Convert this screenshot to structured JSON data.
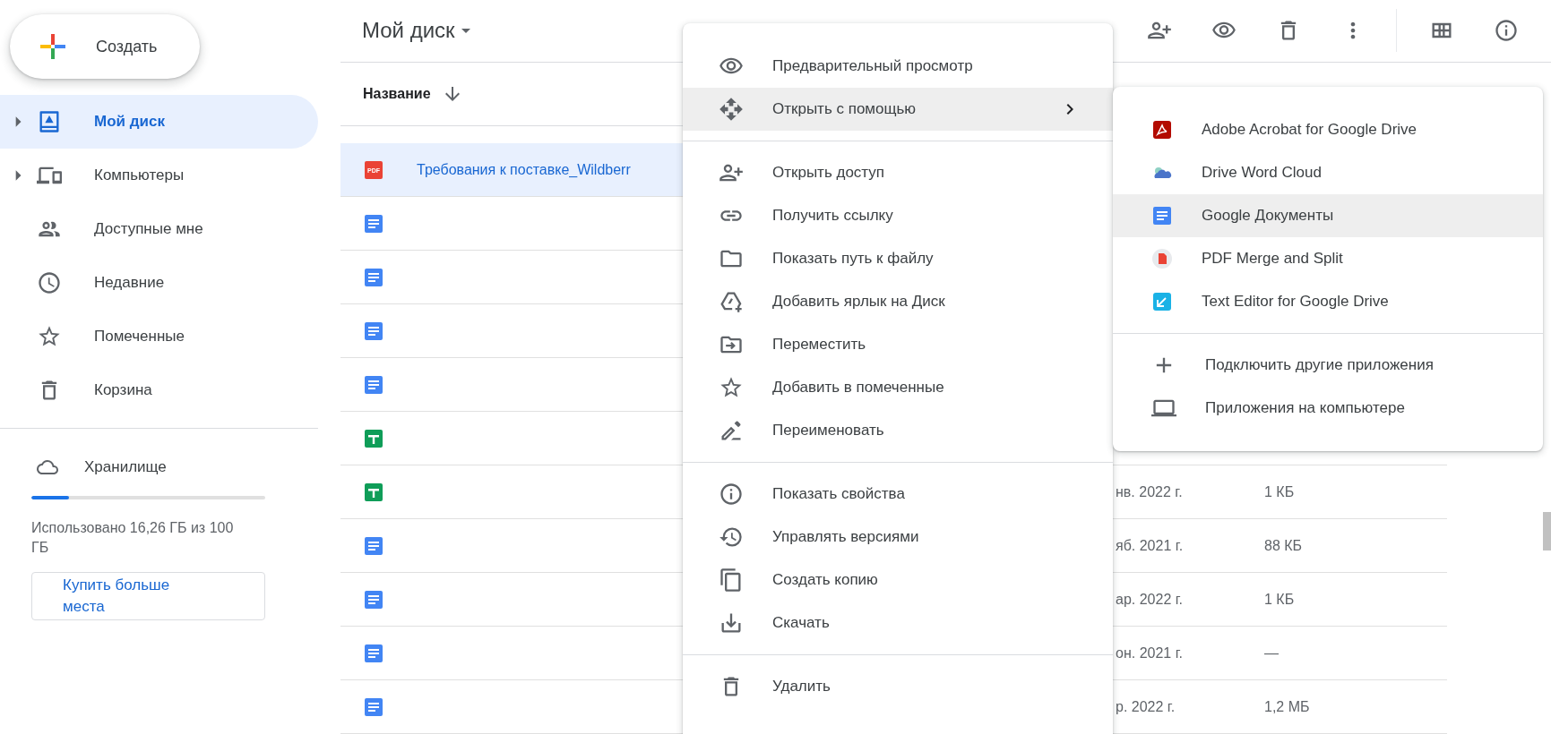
{
  "create_button": {
    "label": "Создать"
  },
  "sidebar": {
    "items": [
      {
        "label": "Мой диск",
        "selected": true,
        "expandable": true
      },
      {
        "label": "Компьютеры",
        "selected": false,
        "expandable": true
      },
      {
        "label": "Доступные мне",
        "selected": false,
        "expandable": false
      },
      {
        "label": "Недавние",
        "selected": false,
        "expandable": false
      },
      {
        "label": "Помеченные",
        "selected": false,
        "expandable": false
      },
      {
        "label": "Корзина",
        "selected": false,
        "expandable": false
      }
    ],
    "storage": {
      "label": "Хранилище",
      "level": 0.16,
      "usage": "Использовано 16,26 ГБ из 100 ГБ",
      "buy_button": "Купить больше места"
    }
  },
  "header": {
    "title": "Мой диск"
  },
  "table": {
    "columns": [
      {
        "label": "Название"
      }
    ],
    "rows": [
      {
        "kind": "pdf",
        "icon_label": "PDF",
        "name": "Требования к поставке_Wildberr",
        "selected": true
      },
      {
        "kind": "doc",
        "selected": false
      },
      {
        "kind": "doc",
        "selected": false
      },
      {
        "kind": "doc",
        "selected": false
      },
      {
        "kind": "doc",
        "selected": false
      },
      {
        "kind": "sheet",
        "selected": false
      },
      {
        "kind": "sheet",
        "selected": false,
        "modified": "нв. 2022 г.",
        "size": "1 КБ"
      },
      {
        "kind": "doc",
        "selected": false,
        "modified": "яб. 2021 г.",
        "size": "88 КБ"
      },
      {
        "kind": "doc",
        "selected": false,
        "modified": "ар. 2022 г.",
        "size": "1 КБ"
      },
      {
        "kind": "doc",
        "selected": false,
        "modified": "он. 2021 г.",
        "size": "—"
      },
      {
        "kind": "doc",
        "selected": false,
        "modified": "р. 2022 г.",
        "size": "1,2 МБ"
      }
    ]
  },
  "context_menu": {
    "groups": [
      [
        {
          "label": "Предварительный просмотр",
          "selected": false,
          "submenu": false
        },
        {
          "label": "Открыть с помощью",
          "selected": true,
          "submenu": true
        }
      ],
      [
        {
          "label": "Открыть доступ",
          "selected": false,
          "submenu": false
        },
        {
          "label": "Получить ссылку",
          "selected": false,
          "submenu": false
        },
        {
          "label": "Показать путь к файлу",
          "selected": false,
          "submenu": false
        },
        {
          "label": "Добавить ярлык на Диск",
          "selected": false,
          "submenu": false
        },
        {
          "label": "Переместить",
          "selected": false,
          "submenu": false
        },
        {
          "label": "Добавить в помеченные",
          "selected": false,
          "submenu": false
        },
        {
          "label": "Переименовать",
          "selected": false,
          "submenu": false
        }
      ],
      [
        {
          "label": "Показать свойства",
          "selected": false,
          "submenu": false
        },
        {
          "label": "Управлять версиями",
          "selected": false,
          "submenu": false
        },
        {
          "label": "Создать копию",
          "selected": false,
          "submenu": false
        },
        {
          "label": "Скачать",
          "selected": false,
          "submenu": false
        }
      ],
      [
        {
          "label": "Удалить",
          "selected": false,
          "submenu": false
        }
      ]
    ]
  },
  "submenu": {
    "groups": [
      [
        {
          "label": "Adobe Acrobat for Google Drive",
          "selected": false
        },
        {
          "label": "Drive Word Cloud",
          "selected": false
        },
        {
          "label": "Google Документы",
          "selected": true
        },
        {
          "label": "PDF Merge and Split",
          "selected": false
        },
        {
          "label": "Text Editor for Google Drive",
          "selected": false
        }
      ],
      [
        {
          "label": "Подключить другие приложения",
          "selected": false
        },
        {
          "label": "Приложения на компьютере",
          "selected": false
        }
      ]
    ]
  }
}
